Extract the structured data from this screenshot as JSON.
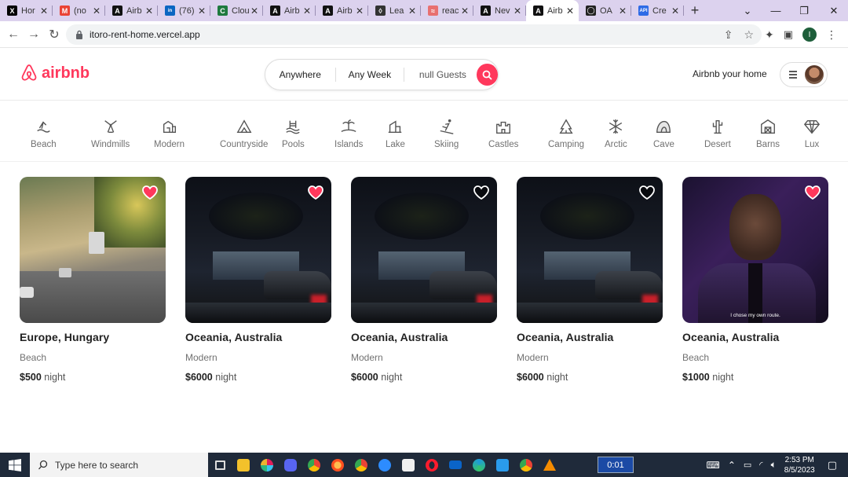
{
  "browser": {
    "tabs": [
      {
        "label": "Hor",
        "icon": "x-twitter-icon",
        "color": "#000000",
        "glyph": "X"
      },
      {
        "label": "(no",
        "icon": "gmail-icon",
        "color": "#ea4335",
        "glyph": "M"
      },
      {
        "label": "Airb",
        "icon": "airbnb-tab-icon",
        "color": "#111111",
        "glyph": "A"
      },
      {
        "label": "(76)",
        "icon": "linkedin-icon",
        "color": "#0a66c2",
        "glyph": "in"
      },
      {
        "label": "Clou",
        "icon": "cloud-icon",
        "color": "#1f7a3f",
        "glyph": "C"
      },
      {
        "label": "Airb",
        "icon": "airbnb-tab-icon",
        "color": "#111111",
        "glyph": "A"
      },
      {
        "label": "Airb",
        "icon": "airbnb-tab-icon",
        "color": "#111111",
        "glyph": "A"
      },
      {
        "label": "Lea",
        "icon": "leaf-icon",
        "color": "#333333",
        "glyph": "◊"
      },
      {
        "label": "reac",
        "icon": "react-icon",
        "color": "#e87070",
        "glyph": "≈"
      },
      {
        "label": "Nev",
        "icon": "airbnb-tab-icon",
        "color": "#111111",
        "glyph": "A"
      },
      {
        "label": "Airb",
        "icon": "airbnb-tab-icon",
        "color": "#111111",
        "glyph": "A",
        "active": true
      },
      {
        "label": "OA",
        "icon": "github-icon",
        "color": "#222222",
        "glyph": "◯"
      },
      {
        "label": "Cre",
        "icon": "api-icon",
        "color": "#2e6be6",
        "glyph": "API"
      }
    ],
    "url": "itoro-rent-home.vercel.app",
    "profile_initial": "I"
  },
  "header": {
    "logo_text": "airbnb",
    "search": {
      "where": "Anywhere",
      "when": "Any Week",
      "guests": "null Guests"
    },
    "host_link": "Airbnb your home"
  },
  "categories": [
    {
      "label": "Beach",
      "icon": "beach-icon"
    },
    {
      "label": "Windmills",
      "icon": "windmill-icon"
    },
    {
      "label": "Modern",
      "icon": "modern-icon"
    },
    {
      "label": "Countryside",
      "icon": "countryside-icon"
    },
    {
      "label": "Pools",
      "icon": "pool-icon"
    },
    {
      "label": "Islands",
      "icon": "island-icon"
    },
    {
      "label": "Lake",
      "icon": "lake-icon"
    },
    {
      "label": "Skiing",
      "icon": "skiing-icon"
    },
    {
      "label": "Castles",
      "icon": "castle-icon"
    },
    {
      "label": "Camping",
      "icon": "camping-icon"
    },
    {
      "label": "Arctic",
      "icon": "snowflake-icon"
    },
    {
      "label": "Cave",
      "icon": "cave-icon"
    },
    {
      "label": "Desert",
      "icon": "cactus-icon"
    },
    {
      "label": "Barns",
      "icon": "barn-icon"
    },
    {
      "label": "Lux",
      "icon": "diamond-icon"
    }
  ],
  "listings": [
    {
      "location": "Europe, Hungary",
      "category": "Beach",
      "price": "$500",
      "unit": "night",
      "favorited": true,
      "photo": "street",
      "caption": ""
    },
    {
      "location": "Oceania, Australia",
      "category": "Modern",
      "price": "$6000",
      "unit": "night",
      "favorited": true,
      "photo": "night",
      "caption": ""
    },
    {
      "location": "Oceania, Australia",
      "category": "Modern",
      "price": "$6000",
      "unit": "night",
      "favorited": false,
      "photo": "night",
      "caption": ""
    },
    {
      "location": "Oceania, Australia",
      "category": "Modern",
      "price": "$6000",
      "unit": "night",
      "favorited": false,
      "photo": "night",
      "caption": ""
    },
    {
      "location": "Oceania, Australia",
      "category": "Beach",
      "price": "$1000",
      "unit": "night",
      "favorited": true,
      "photo": "portrait",
      "caption": "I chose my own route."
    }
  ],
  "taskbar": {
    "search_placeholder": "Type here to search",
    "recording_time": "0:01",
    "time": "2:53 PM",
    "date": "8/5/2023"
  },
  "colors": {
    "brand": "#ff385c",
    "tab_strip": "#dcd2ee",
    "taskbar": "#1f2a3a"
  }
}
